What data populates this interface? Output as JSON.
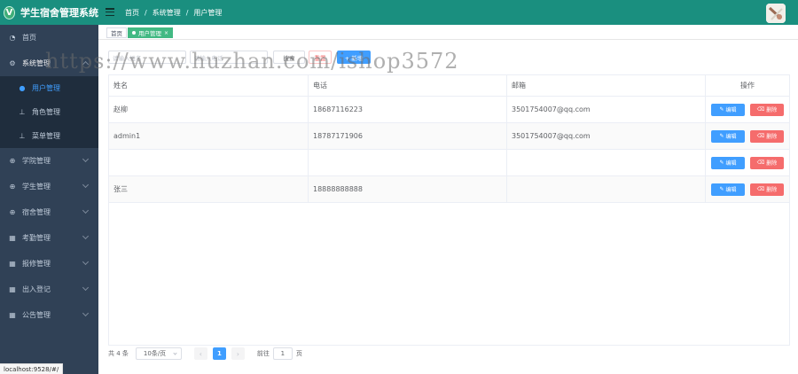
{
  "app": {
    "logo_letter": "V",
    "title": "学生宿舍管理系统"
  },
  "breadcrumb": [
    "首页",
    "系统管理",
    "用户管理"
  ],
  "sidebar": {
    "items": [
      {
        "label": "首页",
        "icon": "dashboard-icon"
      },
      {
        "label": "系统管理",
        "icon": "gear-icon",
        "expanded": true,
        "children": [
          {
            "label": "用户管理",
            "icon": "user-icon",
            "current": true
          },
          {
            "label": "角色管理",
            "icon": "tree-icon"
          },
          {
            "label": "菜单管理",
            "icon": "tree-icon"
          }
        ]
      },
      {
        "label": "学院管理",
        "icon": "plus-circle-icon"
      },
      {
        "label": "学生管理",
        "icon": "plus-circle-icon"
      },
      {
        "label": "宿舍管理",
        "icon": "plus-circle-icon"
      },
      {
        "label": "考勤管理",
        "icon": "grid-icon"
      },
      {
        "label": "报修管理",
        "icon": "grid-icon"
      },
      {
        "label": "出入登记",
        "icon": "grid-icon"
      },
      {
        "label": "公告管理",
        "icon": "grid-icon"
      }
    ]
  },
  "tags": [
    {
      "label": "首页",
      "active": false
    },
    {
      "label": "用户管理",
      "active": true,
      "close": "×"
    }
  ],
  "search": {
    "name_placeholder": "请输入姓名",
    "phone_placeholder": "请输入电话",
    "search_label": "搜索",
    "reset_label": "重置",
    "add_label": "+ 新增"
  },
  "table": {
    "columns": [
      "姓名",
      "电话",
      "邮箱",
      "操作"
    ],
    "edit_label": "编辑",
    "delete_label": "删除",
    "rows": [
      {
        "name": "赵柳",
        "phone": "18687116223",
        "email": "3501754007@qq.com"
      },
      {
        "name": "admin1",
        "phone": "18787171906",
        "email": "3501754007@qq.com"
      },
      {
        "name": "",
        "phone": "",
        "email": ""
      },
      {
        "name": "张三",
        "phone": "18888888888",
        "email": ""
      }
    ]
  },
  "pagination": {
    "total": "共 4 条",
    "page_size": "10条/页",
    "prev": "‹",
    "current": "1",
    "next": "›",
    "goto_label": "前往",
    "goto_value": "1",
    "page_suffix": "页"
  },
  "status_url": "localhost:9528/#/",
  "watermark": "https://www.huzhan.com/ishop3572",
  "colors": {
    "header": "#1a8f7f",
    "sidebar": "#304156",
    "submenu": "#1f2d3d",
    "primary": "#409eff",
    "danger": "#f56c6c",
    "tag_active": "#42b983"
  }
}
